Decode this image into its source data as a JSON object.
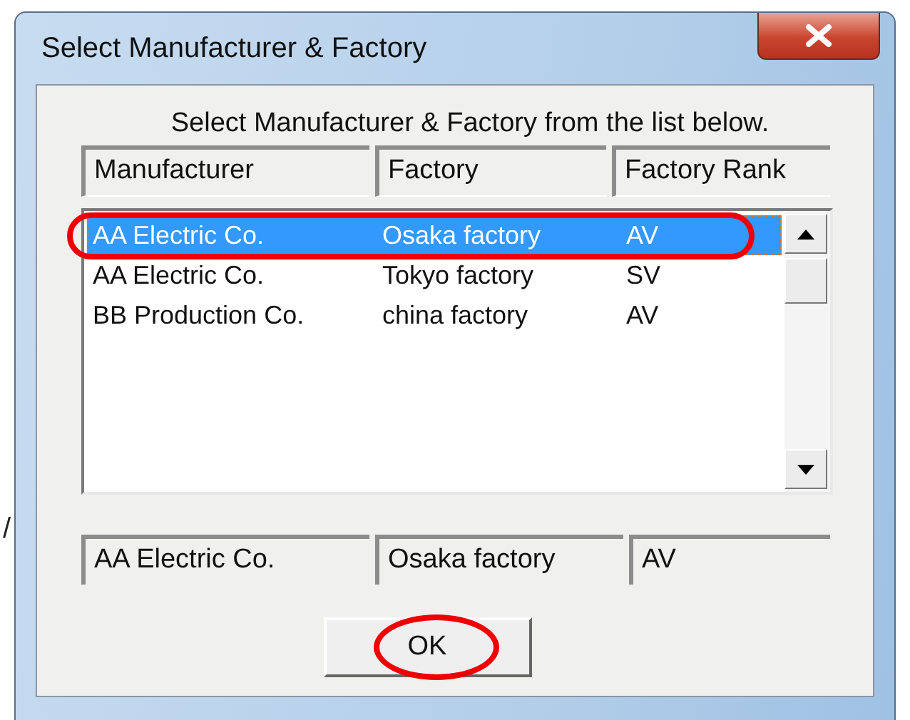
{
  "stray_mark": "/",
  "window": {
    "title": "Select Manufacturer & Factory"
  },
  "instruction": "Select Manufacturer & Factory from the list below.",
  "columns": [
    "Manufacturer",
    "Factory",
    "Factory Rank"
  ],
  "rows": [
    {
      "cells": [
        "AA Electric Co.",
        "Osaka factory",
        "AV"
      ],
      "selected": true,
      "circled": true
    },
    {
      "cells": [
        "AA Electric Co.",
        "Tokyo factory",
        "SV"
      ],
      "selected": false,
      "circled": false
    },
    {
      "cells": [
        "BB Production Co.",
        "china factory",
        "AV"
      ],
      "selected": false,
      "circled": false
    }
  ],
  "selection_fields": [
    "AA Electric Co.",
    "Osaka factory",
    "AV"
  ],
  "ok_button": {
    "label": "OK",
    "circled": true
  }
}
